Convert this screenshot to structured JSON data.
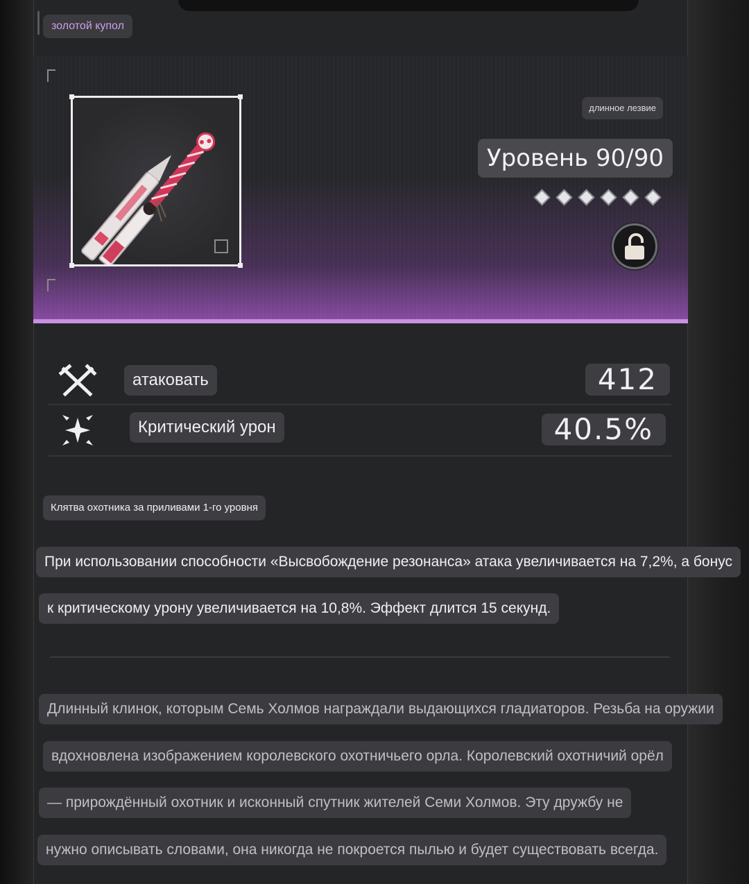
{
  "header": {
    "tag": "золотой купол"
  },
  "weapon": {
    "type": "длинное лезвие",
    "level": "Уровень 90/90",
    "rank_stars": 6,
    "locked": false,
    "icon": "lock-open-icon"
  },
  "stats": [
    {
      "label": "атаковать",
      "value": "412",
      "icon": "attack-swords-icon"
    },
    {
      "label": "Критический урон",
      "value": "40.5%",
      "icon": "crit-burst-icon"
    }
  ],
  "passive": {
    "name": "Клятва охотника за приливами 1-го уровня",
    "lines": [
      "При использовании способности «Высвобождение резонанса» атака увеличивается на 7,2%, а бонус",
      "к критическому урону увеличивается на 10,8%. Эффект длится 15 секунд."
    ]
  },
  "lore": {
    "lines": [
      "Длинный клинок, которым Семь Холмов награждали выдающихся гладиаторов. Резьба на оружии",
      "вдохновлена изображением королевского охотничьего орла. Королевский охотничий орёл",
      "— прирождённый охотник и исконный спутник жителей Семи Холмов. Эту дружбу не",
      "нужно описывать словами, она никогда не покроется пылью и будет существовать всегда."
    ]
  },
  "colors": {
    "accent": "#c792e0",
    "panel": "#242527",
    "pill": "#3e3e42"
  }
}
